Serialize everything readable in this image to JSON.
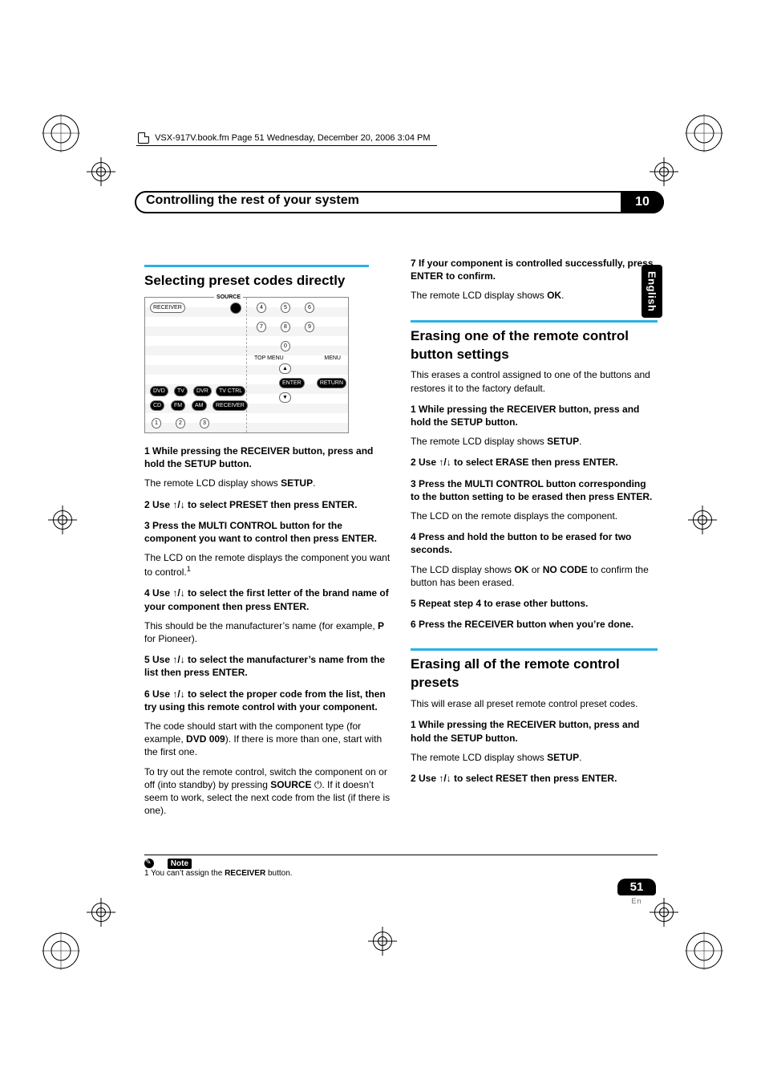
{
  "running_header": "VSX-917V.book.fm  Page 51  Wednesday, December 20, 2006  3:04 PM",
  "chapter": {
    "title": "Controlling the rest of your system",
    "number": "10"
  },
  "language_tab": "English",
  "page_number": "51",
  "page_lang_code": "En",
  "col1": {
    "h_select": "Selecting preset codes directly",
    "remote_labels": {
      "receiver": "RECEIVER",
      "source": "SOURCE",
      "dvd": "DVD",
      "tv": "TV",
      "dvr": "DVR",
      "tvctrl": "TV CTRL",
      "cd": "CD",
      "fm": "FM",
      "am": "AM",
      "receiver2": "RECEIVER",
      "enter": "ENTER",
      "return": "RETURN",
      "topmenu": "TOP MENU",
      "menu": "MENU"
    },
    "s1": "1    While pressing the RECEIVER button, press and hold the SETUP button.",
    "s1b": "The remote LCD display shows ",
    "s1b_bold": "SETUP",
    "s1b_end": ".",
    "s2_pre": "2    Use ",
    "s2_post": " to select PRESET then press ENTER.",
    "s3": "3    Press the MULTI CONTROL button for the component you want to control then press ENTER.",
    "s3b": "The LCD on the remote displays the component you want to control.",
    "s4_pre": "4    Use ",
    "s4_post": " to select the first letter of the brand name of your component then press ENTER.",
    "s4b_a": "This should be the manufacturer’s name (for example, ",
    "s4b_bold": "P",
    "s4b_b": " for Pioneer).",
    "s5_pre": "5    Use ",
    "s5_post": " to select the manufacturer’s name from the list then press ENTER.",
    "s6_pre": "6    Use ",
    "s6_post": " to select the proper code from the list, then try using this remote control with your component.",
    "s6b_a": "The code should start with the component type (for example, ",
    "s6b_bold": "DVD 009",
    "s6b_b": "). If there is more than one, start with the first one.",
    "s6c_a": "To try out the remote control, switch the component on or off (into standby) by pressing ",
    "s6c_bold": "SOURCE",
    "s6c_b": ". If it doesn’t seem to work, select the next code from the list (if there is one).",
    "power_glyph": "⏻"
  },
  "col2": {
    "s7": "7    If your component is controlled successfully, press ENTER to confirm.",
    "s7b_a": "The remote LCD display shows ",
    "s7b_bold": "OK",
    "s7b_b": ".",
    "h_erase_one": "Erasing one of the remote control button settings",
    "p_erase_one": "This erases a control assigned to one of the buttons and restores it to the factory default.",
    "e1": "1    While pressing the RECEIVER button, press and hold the SETUP button.",
    "e1b_a": "The remote LCD display shows ",
    "e1b_bold": "SETUP",
    "e1b_b": ".",
    "e2_pre": "2    Use ",
    "e2_post": " to select ERASE then press ENTER.",
    "e3": "3    Press the MULTI CONTROL button corresponding to the button setting to be erased then press ENTER.",
    "e3b": "The LCD on the remote displays the component.",
    "e4": "4    Press and hold the button to be erased for two seconds.",
    "e4b_a": "The LCD display shows ",
    "e4b_bold1": "OK",
    "e4b_mid": " or ",
    "e4b_bold2": "NO CODE",
    "e4b_b": " to confirm the button has been erased.",
    "e5": "5    Repeat step 4 to erase other buttons.",
    "e6": "6    Press the RECEIVER button when you’re done.",
    "h_erase_all": "Erasing all of the remote control presets",
    "p_erase_all": "This will erase all preset remote control preset codes.",
    "a1": "1    While pressing the RECEIVER button, press and hold the SETUP button.",
    "a1b_a": "The remote LCD display shows ",
    "a1b_bold": "SETUP",
    "a1b_b": ".",
    "a2_pre": "2    Use ",
    "a2_post": " to select RESET then press ENTER."
  },
  "footnote": {
    "label": "Note",
    "text_a": "1 You can’t assign the ",
    "text_bold": "RECEIVER",
    "text_b": " button."
  },
  "glyphs": {
    "updown": "↑/↓"
  }
}
